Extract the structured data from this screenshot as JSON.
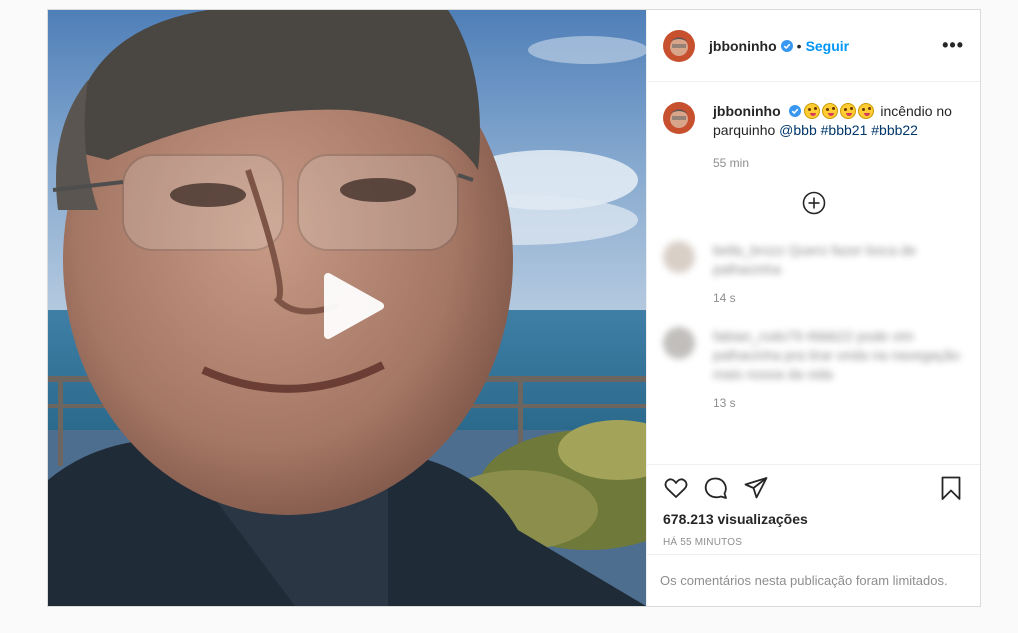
{
  "post": {
    "username": "jbboninho",
    "follow_label": "Seguir",
    "dot": "•",
    "more_label": "•••"
  },
  "caption": {
    "username": "jbboninho",
    "text": "incêndio no parquinho",
    "mention": "@bbb",
    "tags": [
      "#bbb21",
      "#bbb22"
    ],
    "time": "55 min"
  },
  "blurred_comments": [
    {
      "text": "bella_brozz Quero fazer boca de palhacinha",
      "time": "14 s"
    },
    {
      "text": "fabian_rodo79 #bbb22 pode vim palhacinha pra tirar onda na navegação mais nossa da vida",
      "time": "13 s"
    }
  ],
  "footer": {
    "views": "678.213 visualizações",
    "ago": "HÁ 55 MINUTOS",
    "limited": "Os comentários nesta publicação foram limitados."
  },
  "colors": {
    "accent": "#0095f6",
    "verified": "#3897f0",
    "link": "#00376b",
    "muted": "#8e8e8e"
  },
  "icons": [
    "play-icon",
    "verified-icon",
    "more-icon",
    "add-comment-icon",
    "heart-icon",
    "comment-icon",
    "share-icon",
    "save-icon"
  ]
}
